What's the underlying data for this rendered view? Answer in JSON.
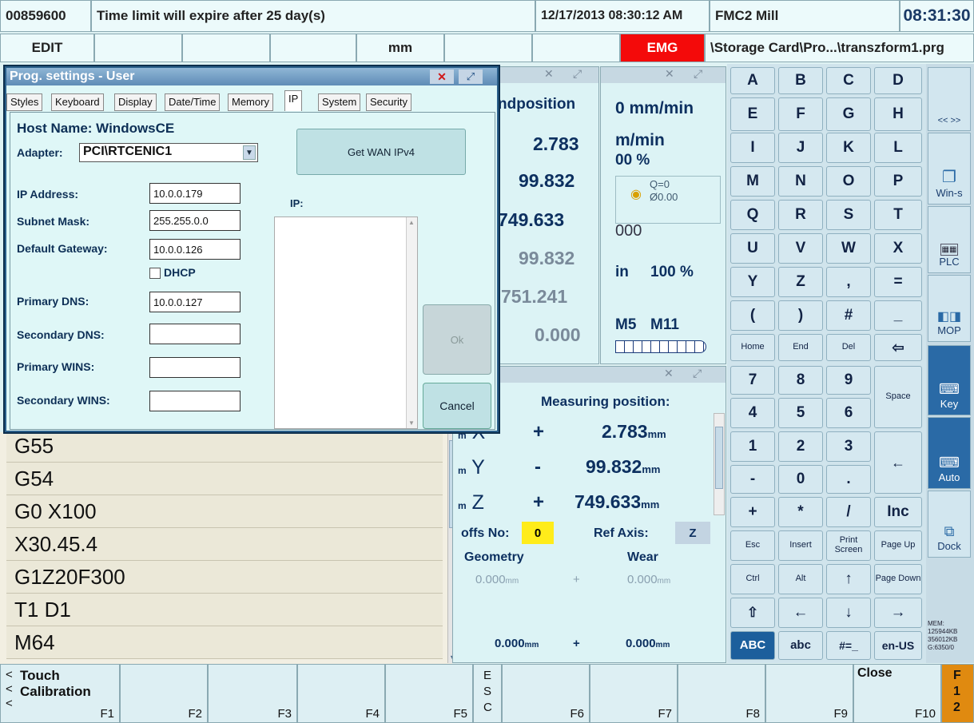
{
  "status_bar": {
    "id": "00859600",
    "message": "Time limit will expire after 25 day(s)",
    "datetime": "12/17/2013 08:30:12 AM",
    "machine": "FMC2 Mill",
    "clock": "08:31:30"
  },
  "mode_bar": {
    "mode": "EDIT",
    "unit": "mm",
    "emg": "EMG",
    "file": "\\Storage Card\\Pro...\\transzform1.prg"
  },
  "program_lines": [
    "G55",
    "G54",
    "G0 X100",
    "X30.45.4",
    "G1Z20F300",
    "T1 D1",
    "M64"
  ],
  "position_panel": {
    "title": "ndposition",
    "values": [
      "2.783",
      "99.832",
      "749.633",
      "99.832",
      "751.241",
      "0.000"
    ]
  },
  "feed_panel": {
    "feed": "0 mm/min",
    "unit2": "m/min",
    "percent": "00 %",
    "q": "Q=0",
    "dia": "Ø0.00",
    "speed_fragment": "000",
    "in_label": "in",
    "spindle_percent": "100 %",
    "m5": "M5",
    "m11": "M11"
  },
  "measure_panel": {
    "title": "Measuring position:",
    "rows": [
      {
        "axis": "X",
        "sign": "+",
        "value": "2.783",
        "unit": "mm",
        "prefix": "m"
      },
      {
        "axis": "Y",
        "sign": "-",
        "value": "99.832",
        "unit": "mm",
        "prefix": "m"
      },
      {
        "axis": "Z",
        "sign": "+",
        "value": "749.633",
        "unit": "mm",
        "prefix": "m"
      }
    ],
    "offs_label": "offs No:",
    "offs_value": "0",
    "ref_label": "Ref Axis:",
    "ref_value": "Z",
    "geometry": "Geometry",
    "wear": "Wear",
    "g1": "0.000",
    "g1unit": "mm",
    "w1": "0.000",
    "w1unit": "mm",
    "plus": "+",
    "g2": "0.000",
    "g2unit": "mm",
    "w2": "0.000",
    "w2unit": "mm"
  },
  "dialog": {
    "title": "Prog. settings - User",
    "tabs": [
      "Styles",
      "Keyboard",
      "Display",
      "Date/Time",
      "Memory",
      "IP",
      "System",
      "Security"
    ],
    "host": "Host Name: WindowsCE",
    "adapter_label": "Adapter:",
    "adapter_value": "PCI\\RTCENIC1",
    "ip_label": "IP Address:",
    "ip": "10.0.0.179",
    "mask_label": "Subnet Mask:",
    "mask": "255.255.0.0",
    "gw_label": "Default Gateway:",
    "gw": "10.0.0.126",
    "dhcp": "DHCP",
    "pdns_label": "Primary DNS:",
    "pdns": "10.0.0.127",
    "sdns_label": "Secondary DNS:",
    "pwins_label": "Primary WINS:",
    "swins_label": "Secondary WINS:",
    "wan_button": "Get WAN IPv4",
    "ip_list_label": "IP:",
    "ok": "Ok",
    "cancel": "Cancel"
  },
  "keyboard": {
    "letters": [
      "A",
      "B",
      "C",
      "D",
      "E",
      "F",
      "G",
      "H",
      "I",
      "J",
      "K",
      "L",
      "M",
      "N",
      "O",
      "P",
      "Q",
      "R",
      "S",
      "T",
      "U",
      "V",
      "W",
      "X",
      "Y",
      "Z",
      ",",
      "=",
      "(",
      ")",
      "#",
      "_"
    ],
    "home": "Home",
    "end": "End",
    "del": "Del",
    "back": "⇦",
    "nums": [
      "7",
      "8",
      "9",
      "4",
      "5",
      "6",
      "1",
      "2",
      "3",
      "-",
      "0",
      "."
    ],
    "space": "Space",
    "enter": "←",
    "plus": "+",
    "star": "*",
    "slash": "/",
    "inc": "Inc",
    "esc": "Esc",
    "insert": "Insert",
    "print": "Print Screen",
    "pgup": "Page Up",
    "ctrl": "Ctrl",
    "alt": "Alt",
    "up": "↑",
    "pgdn": "Page Down",
    "shift": "⇧",
    "left": "←",
    "down": "↓",
    "right": "→",
    "abc_upper": "ABC",
    "abc_lower": "abc",
    "sym": "#=_",
    "lang": "en-US"
  },
  "right_panel": {
    "scroll": "<< >>",
    "wins": "Win-s",
    "plc": "PLC",
    "mop": "MOP",
    "key": "Key",
    "auto": "Auto",
    "dock": "Dock",
    "mem1": "MEM:",
    "mem2": "125944KB",
    "mem3": "356012KB",
    "mem4": "G:6350/0"
  },
  "fkeys": {
    "touch1": "Touch",
    "touch2": "Calibration",
    "labels": [
      "F1",
      "F2",
      "F3",
      "F4",
      "F5",
      "F6",
      "F7",
      "F8",
      "F9",
      "F10"
    ],
    "esc_chars": [
      "E",
      "S",
      "C"
    ],
    "close": "Close",
    "f12a": "F",
    "f12b": "1",
    "f12c": "2",
    "arrows": [
      "<",
      "<",
      "<"
    ]
  }
}
